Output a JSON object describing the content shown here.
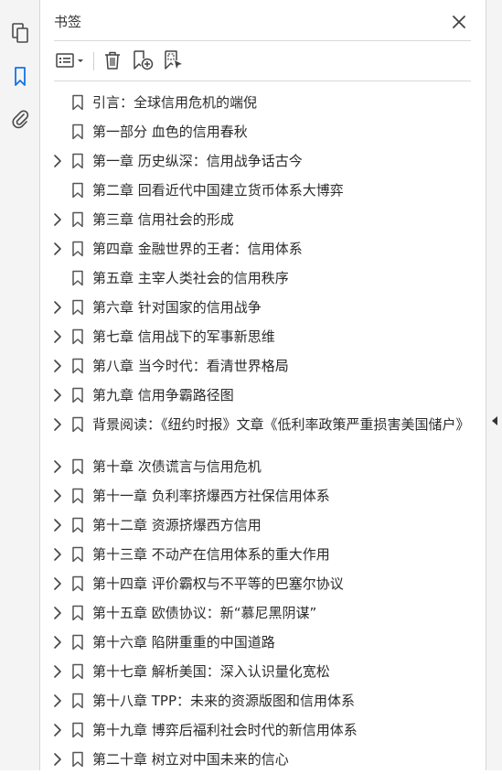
{
  "panel": {
    "title": "书签",
    "close_icon": "close-icon"
  },
  "toolbar": {
    "items": [
      "options-menu-icon",
      "delete-icon",
      "new-bookmark-icon",
      "bookmark-from-selection-icon"
    ]
  },
  "bookmarks": [
    {
      "label": "引言：全球信用危机的端倪",
      "expandable": false
    },
    {
      "label": "第一部分  血色的信用春秋",
      "expandable": false
    },
    {
      "label": "第一章  历史纵深：信用战争话古今",
      "expandable": true
    },
    {
      "label": "第二章  回看近代中国建立货币体系大博弈",
      "expandable": false
    },
    {
      "label": "第三章  信用社会的形成",
      "expandable": true
    },
    {
      "label": "第四章  金融世界的王者：信用体系",
      "expandable": true
    },
    {
      "label": "第五章  主宰人类社会的信用秩序",
      "expandable": false
    },
    {
      "label": "第六章  针对国家的信用战争",
      "expandable": true
    },
    {
      "label": "第七章  信用战下的军事新思维",
      "expandable": true
    },
    {
      "label": "第八章  当今时代：看清世界格局",
      "expandable": true
    },
    {
      "label": "第九章  信用争霸路径图",
      "expandable": true
    },
    {
      "label": "背景阅读：《纽约时报》文章《低利率政策严重损害美国储户》",
      "expandable": true
    },
    {
      "label": "第十章  次债谎言与信用危机",
      "expandable": true
    },
    {
      "label": "第十一章  负利率挤爆西方社保信用体系",
      "expandable": true
    },
    {
      "label": "第十二章  资源挤爆西方信用",
      "expandable": true
    },
    {
      "label": "第十三章  不动产在信用体系的重大作用",
      "expandable": true
    },
    {
      "label": "第十四章  评价霸权与不平等的巴塞尔协议",
      "expandable": true
    },
    {
      "label": "第十五章  欧债协议：新“慕尼黑阴谋”",
      "expandable": true
    },
    {
      "label": "第十六章  陷阱重重的中国道路",
      "expandable": true
    },
    {
      "label": "第十七章  解析美国：深入认识量化宽松",
      "expandable": true
    },
    {
      "label": "第十八章  TPP：未来的资源版图和信用体系",
      "expandable": true
    },
    {
      "label": "第十九章  博弈后福利社会时代的新信用体系",
      "expandable": true
    },
    {
      "label": "第二十章  树立对中国未来的信心",
      "expandable": true
    }
  ]
}
